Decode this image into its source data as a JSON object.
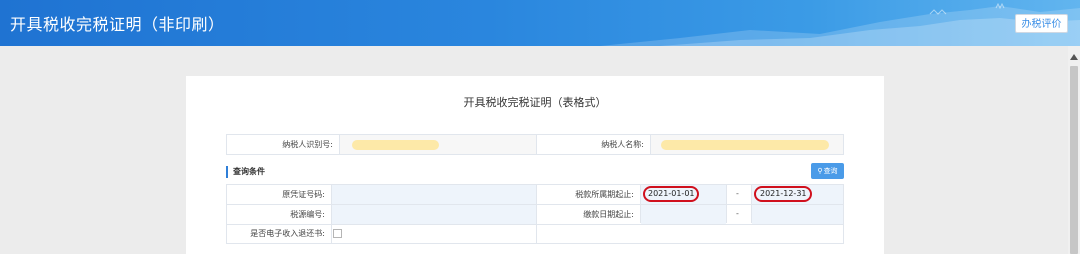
{
  "header": {
    "title": "开具税收完税证明（非印刷）",
    "eval_button": "办税评价"
  },
  "card": {
    "title": "开具税收完税证明（表格式）",
    "taxpayer_id_label": "纳税人识别号:",
    "taxpayer_name_label": "纳税人名称:",
    "section_title": "查询条件",
    "query_button": "查询",
    "fields": {
      "voucher_no_label": "原凭证号码:",
      "tax_period_label": "税款所属期起止:",
      "tax_period_start": "2021-01-01",
      "tax_period_end": "2021-12-31",
      "range_sep": "-",
      "tax_source_no_label": "税源编号:",
      "payment_date_label": "缴款日期起止:",
      "e_refund_label": "是否电子收入退还书:"
    }
  },
  "colors": {
    "header_blue": "#1f73d2",
    "accent_blue": "#4a9be8",
    "highlight_yellow": "#fde9a8",
    "annotation_red": "#d0101d"
  }
}
